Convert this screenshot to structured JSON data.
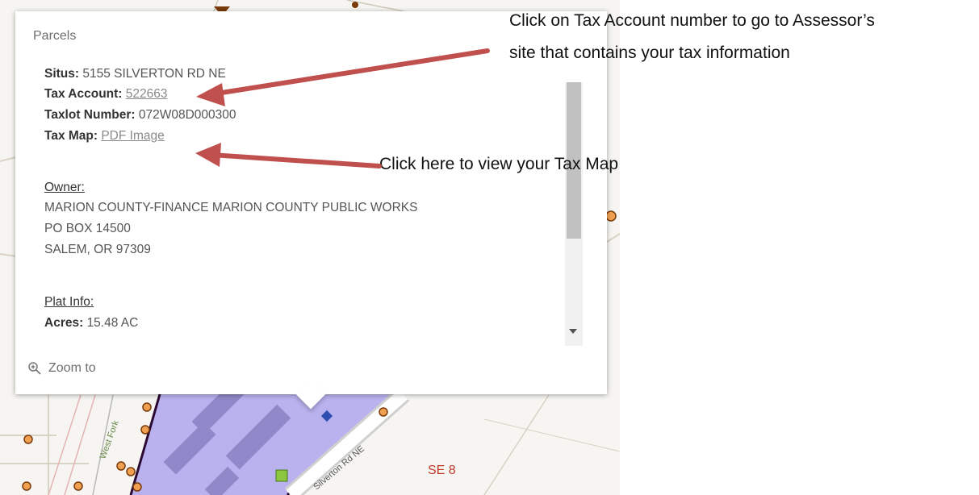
{
  "popup": {
    "title": "Parcels",
    "situs": {
      "label": "Situs:",
      "value": "5155 SILVERTON RD NE"
    },
    "tax_account": {
      "label": "Tax Account:",
      "value": "522663"
    },
    "taxlot_number": {
      "label": "Taxlot Number:",
      "value": "072W08D000300"
    },
    "tax_map": {
      "label": "Tax Map:",
      "value": "PDF Image"
    },
    "owner": {
      "header": "Owner:",
      "lines": [
        "MARION COUNTY-FINANCE MARION COUNTY PUBLIC WORKS",
        "PO BOX 14500",
        "SALEM, OR 97309"
      ]
    },
    "plat_info": {
      "header": "Plat Info:"
    },
    "acres": {
      "label": "Acres:",
      "value": "15.48 AC"
    },
    "zoom_label": "Zoom to"
  },
  "annotations": {
    "tax_account_note_line1": "Click on Tax Account number to go to Assessor’s",
    "tax_account_note_line2": "site that contains your tax information",
    "tax_map_note": "Click here to view your Tax Map"
  },
  "map": {
    "labels": {
      "section": "SE 8",
      "road": "Silverton Rd NE",
      "street": "West Fork"
    }
  },
  "colors": {
    "arrow": "#c0504d",
    "parcel_fill": "#b9b2ee",
    "parcel_outline": "#2b0a33",
    "section_label": "#c0392b"
  }
}
